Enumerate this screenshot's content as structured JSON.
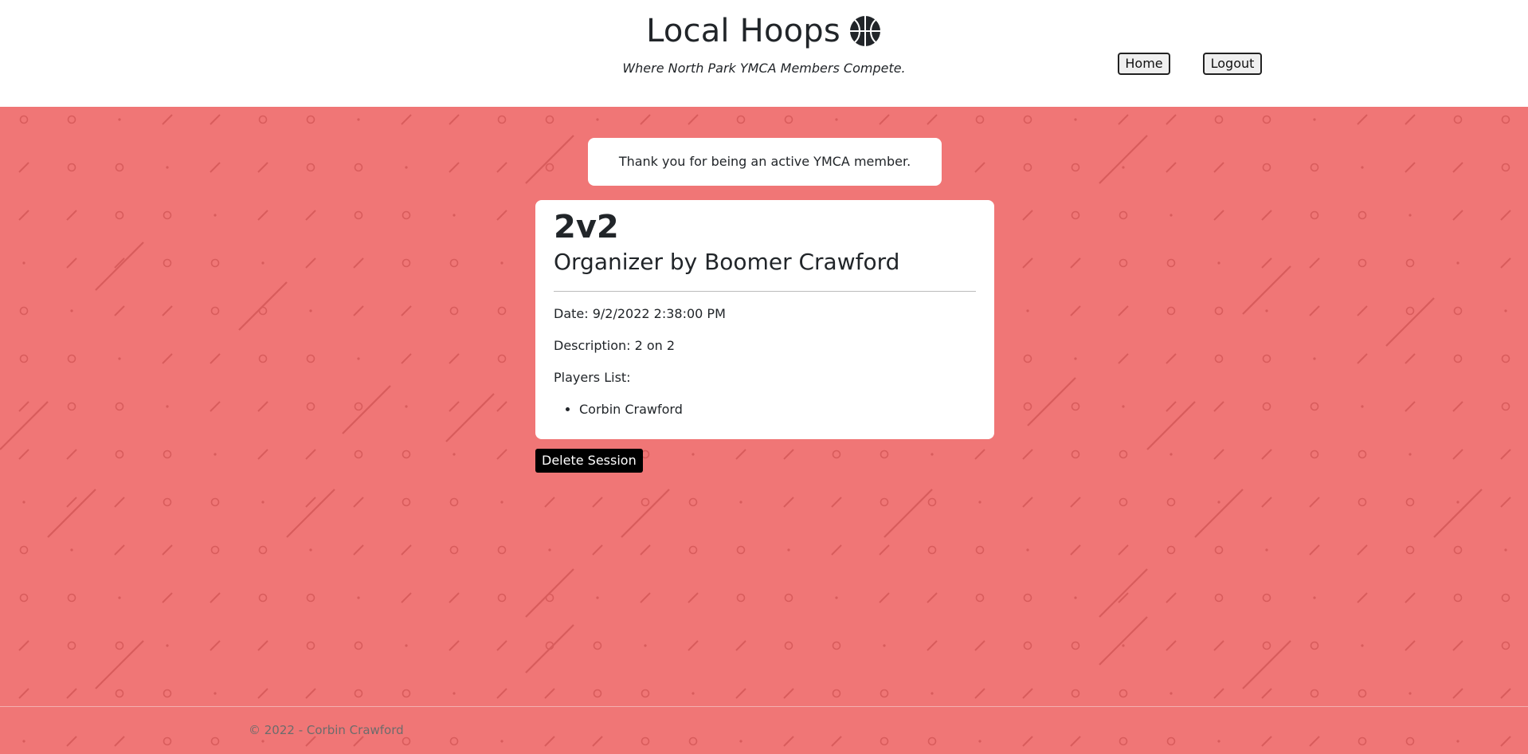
{
  "header": {
    "title": "Local Hoops",
    "logo_icon": "basketball-icon",
    "tagline": "Where North Park YMCA Members Compete.",
    "nav": {
      "home_label": "Home",
      "logout_label": "Logout"
    }
  },
  "notice": {
    "text": "Thank you for being an active YMCA member."
  },
  "session": {
    "title": "2v2",
    "organizer": "Organizer by Boomer Crawford",
    "date": "Date: 9/2/2022 2:38:00 PM",
    "description": "Description: 2 on 2",
    "players_label": "Players List:",
    "players": [
      "Corbin Crawford"
    ]
  },
  "actions": {
    "delete_label": "Delete Session"
  },
  "footer": {
    "text": "© 2022 - Corbin Crawford"
  },
  "colors": {
    "background": "#f07676",
    "pattern": "#d85c5c",
    "card": "#ffffff",
    "button": "#000000"
  }
}
